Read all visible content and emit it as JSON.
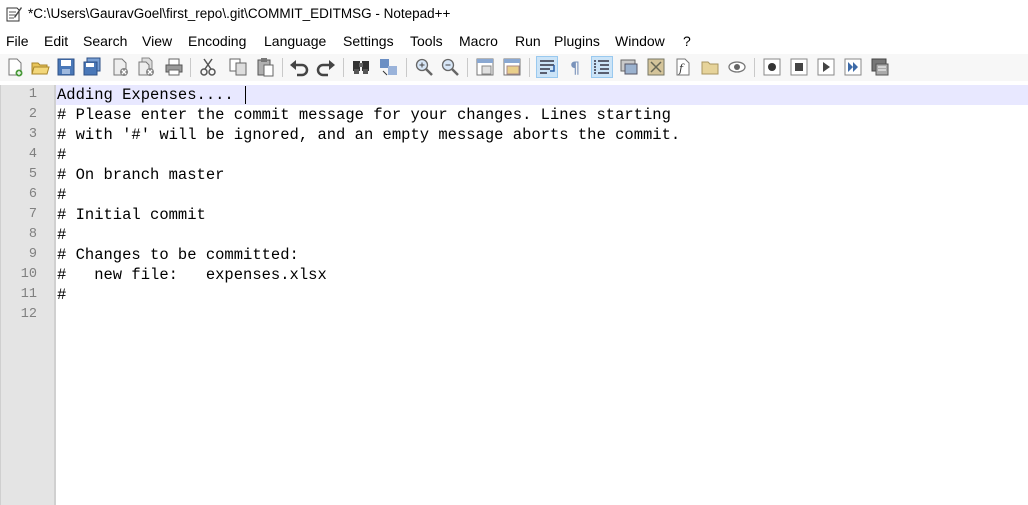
{
  "window": {
    "title": "*C:\\Users\\GauravGoel\\first_repo\\.git\\COMMIT_EDITMSG - Notepad++"
  },
  "menu": [
    "File",
    "Edit",
    "Search",
    "View",
    "Encoding",
    "Language",
    "Settings",
    "Tools",
    "Macro",
    "Run",
    "Plugins",
    "Window",
    "?"
  ],
  "toolbar": [
    "new-file-icon",
    "open-file-icon",
    "save-icon",
    "save-all-icon",
    "close-icon",
    "close-all-icon",
    "print-icon",
    "cut-icon",
    "copy-icon",
    "paste-icon",
    "undo-icon",
    "redo-icon",
    "find-icon",
    "replace-icon",
    "zoom-in-icon",
    "zoom-out-icon",
    "sync-vertical-icon",
    "sync-horizontal-icon",
    "word-wrap-icon",
    "show-all-characters-icon",
    "indent-guide-icon",
    "user-defined-language-icon",
    "doc-map-icon",
    "function-list-icon",
    "folder-as-workspace-icon",
    "monitoring-icon",
    "record-macro-icon",
    "stop-record-icon",
    "playback-macro-icon",
    "run-macro-multiple-icon",
    "save-macro-icon"
  ],
  "editor": {
    "lines": [
      "Adding Expenses....",
      "# Please enter the commit message for your changes. Lines starting",
      "# with '#' will be ignored, and an empty message aborts the commit.",
      "#",
      "# On branch master",
      "#",
      "# Initial commit",
      "#",
      "# Changes to be committed:",
      "#   new file:   expenses.xlsx",
      "#",
      ""
    ],
    "line_numbers": [
      "1",
      "2",
      "3",
      "4",
      "5",
      "6",
      "7",
      "8",
      "9",
      "10",
      "11",
      "12"
    ]
  }
}
